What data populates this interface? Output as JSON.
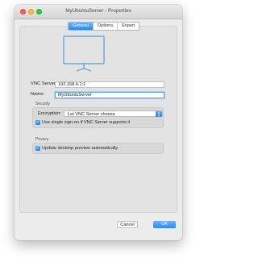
{
  "window": {
    "title": "MyUbuntuServer - Properties"
  },
  "tabs": [
    {
      "label": "General",
      "active": true
    },
    {
      "label": "Options",
      "active": false
    },
    {
      "label": "Expert",
      "active": false
    }
  ],
  "general": {
    "preview_icon": "monitor-icon",
    "vnc_server_label": "VNC Server:",
    "vnc_server_value": "192.168.4.1:1",
    "name_label": "Name:",
    "name_value": "MyUbuntuServer"
  },
  "security": {
    "heading": "Security",
    "encryption_label": "Encryption:",
    "encryption_value": "Let VNC Server choose",
    "sso_label": "Use single sign-on if VNC Server supports it",
    "sso_checked": true
  },
  "privacy": {
    "heading": "Privacy",
    "preview_label": "Update desktop preview automatically",
    "preview_checked": true
  },
  "buttons": {
    "cancel": "Cancel",
    "ok": "OK"
  },
  "colors": {
    "accent": "#2a8af6",
    "close": "#fc605c",
    "minimize": "#fdbc40",
    "maximize": "#34c84a"
  }
}
